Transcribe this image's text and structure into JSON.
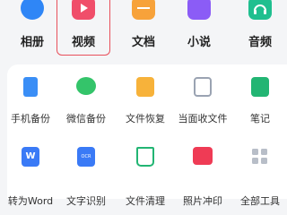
{
  "categories": [
    {
      "label": "相册",
      "icon": "album-icon",
      "color": "#2f86f6"
    },
    {
      "label": "视频",
      "icon": "video-icon",
      "color": "#f04e6a",
      "selected": true
    },
    {
      "label": "文档",
      "icon": "document-icon",
      "color": "#f7a23a"
    },
    {
      "label": "小说",
      "icon": "novel-icon",
      "color": "#8b5cf6"
    },
    {
      "label": "音频",
      "icon": "audio-icon",
      "color": "#1fbf8f"
    }
  ],
  "tools_row1": [
    {
      "label": "手机备份",
      "icon": "phone-backup-icon",
      "color": "#3a8ef6"
    },
    {
      "label": "微信备份",
      "icon": "wechat-backup-icon",
      "color": "#34c46a"
    },
    {
      "label": "文件恢复",
      "icon": "file-restore-icon",
      "color": "#f7b23a"
    },
    {
      "label": "当面收文件",
      "icon": "receive-file-icon",
      "color": "#9aa3b2"
    },
    {
      "label": "笔记",
      "icon": "notes-icon",
      "color": "#22b573"
    }
  ],
  "tools_row2": [
    {
      "label": "转为Word",
      "icon": "to-word-icon",
      "color": "#3a7af6",
      "glyph": "W"
    },
    {
      "label": "文字识别",
      "icon": "ocr-icon",
      "color": "#3a7af6",
      "glyph": "OCR"
    },
    {
      "label": "文件清理",
      "icon": "file-clean-icon",
      "color": "#22b573"
    },
    {
      "label": "照片冲印",
      "icon": "photo-print-icon",
      "color": "#ef3b55"
    },
    {
      "label": "全部工具",
      "icon": "all-tools-icon",
      "color": "#b8bec8"
    }
  ]
}
